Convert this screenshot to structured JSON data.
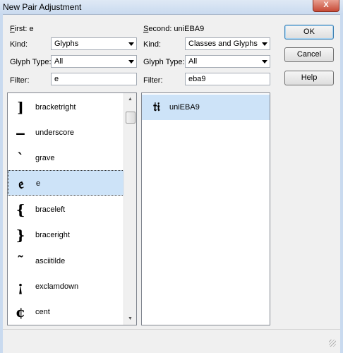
{
  "window": {
    "title": "New Pair Adjustment",
    "close_label": "X"
  },
  "first": {
    "header_accel": "F",
    "header_rest": "irst: e",
    "kind_label": "Kind:",
    "kind_value": "Glyphs",
    "glyph_type_label": "Glyph Type:",
    "glyph_type_value": "All",
    "filter_label": "Filter:",
    "filter_value": "e",
    "items": [
      {
        "glyph": "]",
        "name": "bracketright"
      },
      {
        "glyph": "‒",
        "name": "underscore"
      },
      {
        "glyph": "ˋ",
        "name": "grave"
      },
      {
        "glyph": "𝔢",
        "name": "e"
      },
      {
        "glyph": "{",
        "name": "braceleft"
      },
      {
        "glyph": "}",
        "name": "braceright"
      },
      {
        "glyph": "˜",
        "name": "asciitilde"
      },
      {
        "glyph": "¡",
        "name": "exclamdown"
      },
      {
        "glyph": "¢",
        "name": "cent"
      }
    ]
  },
  "second": {
    "header_accel": "S",
    "header_rest": "econd: uniEBA9",
    "kind_label": "Kind:",
    "kind_value": "Classes and Glyphs",
    "glyph_type_label": "Glyph Type:",
    "glyph_type_value": "All",
    "filter_label": "Filter:",
    "filter_value": "eba9",
    "items": [
      {
        "glyph": "𝔱𝔦",
        "name": "uniEBA9"
      }
    ]
  },
  "buttons": {
    "ok": "OK",
    "cancel": "Cancel",
    "help": "Help"
  }
}
